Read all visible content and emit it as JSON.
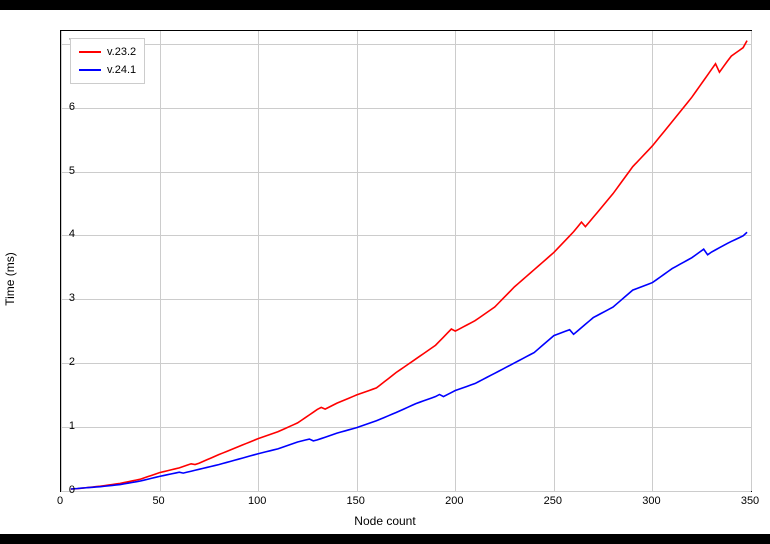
{
  "chart_data": {
    "type": "line",
    "xlabel": "Node count",
    "ylabel": "Time (ms)",
    "xlim": [
      0,
      350
    ],
    "ylim": [
      0,
      7.2
    ],
    "xticks": [
      0,
      50,
      100,
      150,
      200,
      250,
      300,
      350
    ],
    "yticks": [
      0,
      1,
      2,
      3,
      4,
      5,
      6,
      7
    ],
    "legend_position": "upper-left",
    "grid": true,
    "series": [
      {
        "name": "v.23.2",
        "color": "#ff0000",
        "x": [
          5,
          10,
          20,
          30,
          40,
          50,
          60,
          70,
          80,
          90,
          100,
          110,
          120,
          130,
          140,
          150,
          160,
          170,
          180,
          190,
          200,
          210,
          220,
          230,
          240,
          250,
          260,
          270,
          280,
          290,
          300,
          310,
          320,
          330,
          340,
          348
        ],
        "y": [
          0.04,
          0.05,
          0.08,
          0.12,
          0.18,
          0.28,
          0.35,
          0.45,
          0.58,
          0.7,
          0.82,
          0.92,
          1.05,
          1.25,
          1.4,
          1.52,
          1.62,
          1.85,
          2.05,
          2.25,
          2.55,
          2.7,
          2.9,
          3.2,
          3.45,
          3.7,
          4.0,
          4.35,
          4.7,
          5.1,
          5.4,
          5.75,
          6.1,
          6.5,
          6.9,
          7.05
        ]
      },
      {
        "name": "v.24.1",
        "color": "#0000ff",
        "x": [
          5,
          10,
          20,
          30,
          40,
          50,
          60,
          70,
          80,
          90,
          100,
          110,
          120,
          130,
          140,
          150,
          160,
          170,
          180,
          190,
          200,
          210,
          220,
          230,
          240,
          250,
          260,
          270,
          280,
          290,
          300,
          310,
          320,
          330,
          340,
          348
        ],
        "y": [
          0.04,
          0.05,
          0.07,
          0.1,
          0.15,
          0.22,
          0.28,
          0.35,
          0.42,
          0.5,
          0.58,
          0.65,
          0.75,
          0.82,
          0.92,
          1.0,
          1.1,
          1.22,
          1.35,
          1.45,
          1.6,
          1.7,
          1.85,
          2.0,
          2.15,
          2.4,
          2.5,
          2.75,
          2.9,
          3.15,
          3.25,
          3.45,
          3.6,
          3.8,
          3.95,
          4.05
        ]
      }
    ]
  }
}
